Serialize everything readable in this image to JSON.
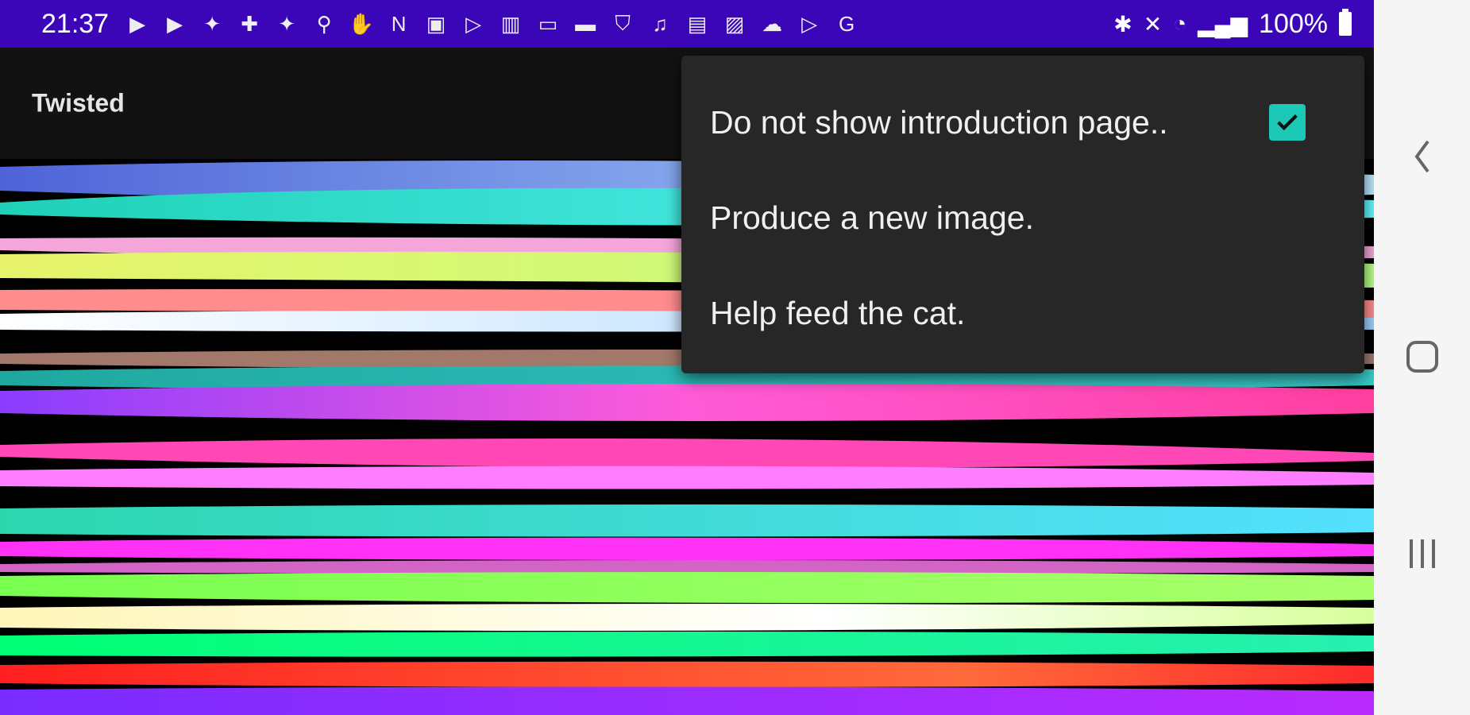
{
  "status_bar": {
    "time": "21:37",
    "battery": "100%",
    "notification_icons": [
      "youtube-icon",
      "youtube-icon",
      "twitter-icon",
      "slack-icon",
      "twitter-icon",
      "usb-icon",
      "hand-icon",
      "n-icon",
      "wifi-box-icon",
      "play-icon",
      "chart-icon",
      "msg-icon",
      "card-icon",
      "shield-icon",
      "music-icon",
      "lock-icon",
      "image-icon",
      "cloud-icon",
      "play-store-icon",
      "google-icon"
    ]
  },
  "app_bar": {
    "title": "Twisted"
  },
  "menu": {
    "items": [
      {
        "label": "Do not show introduction page..",
        "checked": true
      },
      {
        "label": "Produce a new image."
      },
      {
        "label": "Help feed the cat."
      }
    ]
  },
  "colors": {
    "status_bar_bg": "#3a06b8",
    "app_bar_bg": "#121212",
    "menu_bg": "#272727",
    "checkbox": "#1ec8b7"
  },
  "nav_bar": {
    "back": "back-icon",
    "home": "home-icon",
    "recents": "recents-icon"
  }
}
